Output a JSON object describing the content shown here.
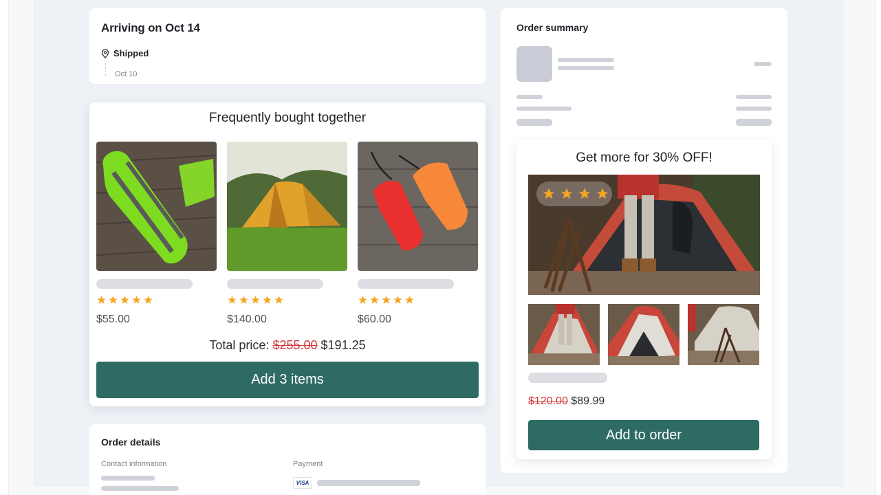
{
  "arrival": {
    "title": "Arriving on Oct 14",
    "status": "Shipped",
    "status_date": "Oct 10"
  },
  "bundle": {
    "title": "Frequently bought together",
    "products": [
      {
        "image": "green-sleeping-bag",
        "rating": 5,
        "price": "$55.00"
      },
      {
        "image": "orange-tent",
        "rating": 5,
        "price": "$140.00"
      },
      {
        "image": "stuff-sacks",
        "rating": 5,
        "price": "$60.00"
      }
    ],
    "total_label": "Total price:",
    "total_old": "$255.00",
    "total_new": "$191.25",
    "button_label": "Add 3 items"
  },
  "order_details": {
    "title": "Order details",
    "contact_label": "Contact information",
    "payment_label": "Payment",
    "card_brand": "VISA"
  },
  "summary": {
    "title": "Order summary"
  },
  "upsell": {
    "title": "Get more for 30% OFF!",
    "hero_rating": 4,
    "old_price": "$120.00",
    "new_price": "$89.99",
    "button_label": "Add to order"
  },
  "colors": {
    "accent": "#2e6b64",
    "star": "#f5a623",
    "strike": "#d13b3b",
    "skeleton": "#dcdee3"
  },
  "icons": {
    "location": "map-pin-icon",
    "rating": "star-icon"
  }
}
